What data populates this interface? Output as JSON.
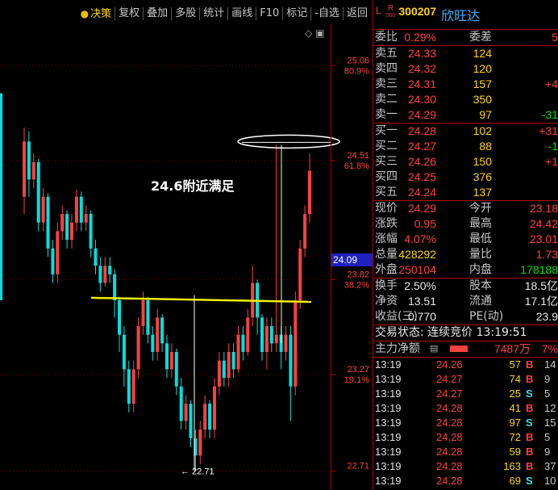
{
  "toolbar": {
    "items": [
      "决策",
      "复权",
      "叠加",
      "多股",
      "统计",
      "画线",
      "F10",
      "标记",
      "-自选",
      "返回"
    ]
  },
  "chart": {
    "annotation": "24.6附近满足",
    "low_label": "← 22.71",
    "current_price_tag": "24.09",
    "axis_labels": [
      {
        "price": "25.06",
        "pct": "80.9%"
      },
      {
        "price": "24.51",
        "pct": "61.8%"
      },
      {
        "price": "23.82",
        "pct": "38.2%"
      },
      {
        "price": "23.27",
        "pct": "19.1%"
      },
      {
        "price": "22.71",
        "pct": ""
      }
    ],
    "candle_colors": {
      "up": "#ff4040",
      "down": "#00e0e0",
      "line": "#f0f000"
    }
  },
  "chart_data": {
    "type": "candlestick",
    "y_range": [
      22.6,
      25.3
    ],
    "fib_levels": [
      25.06,
      24.51,
      23.82,
      23.27,
      22.71
    ],
    "support_line_price": 23.7,
    "candles": [
      {
        "o": 24.3,
        "c": 24.62,
        "h": 24.7,
        "l": 24.2
      },
      {
        "o": 24.62,
        "c": 24.4,
        "h": 24.68,
        "l": 24.3
      },
      {
        "o": 24.4,
        "c": 24.5,
        "h": 24.55,
        "l": 24.35
      },
      {
        "o": 24.5,
        "c": 24.15,
        "h": 24.52,
        "l": 24.1
      },
      {
        "o": 24.15,
        "c": 24.3,
        "h": 24.35,
        "l": 24.1
      },
      {
        "o": 24.3,
        "c": 24.0,
        "h": 24.32,
        "l": 23.95
      },
      {
        "o": 24.0,
        "c": 23.85,
        "h": 24.05,
        "l": 23.8
      },
      {
        "o": 23.85,
        "c": 24.1,
        "h": 24.15,
        "l": 23.8
      },
      {
        "o": 24.1,
        "c": 24.2,
        "h": 24.25,
        "l": 24.05
      },
      {
        "o": 24.2,
        "c": 24.05,
        "h": 24.22,
        "l": 24.0
      },
      {
        "o": 24.05,
        "c": 24.15,
        "h": 24.2,
        "l": 24.0
      },
      {
        "o": 24.15,
        "c": 24.3,
        "h": 24.34,
        "l": 24.1
      },
      {
        "o": 24.3,
        "c": 24.15,
        "h": 24.33,
        "l": 24.1
      },
      {
        "o": 24.15,
        "c": 24.2,
        "h": 24.25,
        "l": 24.1
      },
      {
        "o": 24.2,
        "c": 24.0,
        "h": 24.22,
        "l": 23.95
      },
      {
        "o": 24.0,
        "c": 23.9,
        "h": 24.05,
        "l": 23.85
      },
      {
        "o": 23.9,
        "c": 23.8,
        "h": 23.95,
        "l": 23.75
      },
      {
        "o": 23.8,
        "c": 23.9,
        "h": 23.95,
        "l": 23.78
      },
      {
        "o": 23.9,
        "c": 23.85,
        "h": 23.95,
        "l": 23.8
      },
      {
        "o": 23.85,
        "c": 23.7,
        "h": 23.88,
        "l": 23.6
      },
      {
        "o": 23.7,
        "c": 23.5,
        "h": 23.72,
        "l": 23.4
      },
      {
        "o": 23.5,
        "c": 23.3,
        "h": 23.55,
        "l": 23.2
      },
      {
        "o": 23.3,
        "c": 23.1,
        "h": 23.35,
        "l": 23.05
      },
      {
        "o": 23.1,
        "c": 23.3,
        "h": 23.35,
        "l": 23.05
      },
      {
        "o": 23.3,
        "c": 23.55,
        "h": 23.6,
        "l": 23.25
      },
      {
        "o": 23.55,
        "c": 23.7,
        "h": 23.75,
        "l": 23.5
      },
      {
        "o": 23.7,
        "c": 23.5,
        "h": 23.72,
        "l": 23.45
      },
      {
        "o": 23.5,
        "c": 23.4,
        "h": 23.55,
        "l": 23.35
      },
      {
        "o": 23.4,
        "c": 23.6,
        "h": 23.65,
        "l": 23.35
      },
      {
        "o": 23.6,
        "c": 23.45,
        "h": 23.62,
        "l": 23.4
      },
      {
        "o": 23.45,
        "c": 23.3,
        "h": 23.5,
        "l": 23.25
      },
      {
        "o": 23.3,
        "c": 23.4,
        "h": 23.45,
        "l": 23.25
      },
      {
        "o": 23.4,
        "c": 23.2,
        "h": 23.42,
        "l": 23.15
      },
      {
        "o": 23.2,
        "c": 23.0,
        "h": 23.25,
        "l": 22.95
      },
      {
        "o": 23.0,
        "c": 23.1,
        "h": 23.15,
        "l": 22.95
      },
      {
        "o": 23.1,
        "c": 22.9,
        "h": 23.12,
        "l": 22.85
      },
      {
        "o": 22.9,
        "c": 22.8,
        "h": 22.95,
        "l": 22.71
      },
      {
        "o": 22.8,
        "c": 22.95,
        "h": 23.0,
        "l": 22.75
      },
      {
        "o": 22.95,
        "c": 23.1,
        "h": 23.15,
        "l": 22.9
      },
      {
        "o": 23.1,
        "c": 22.95,
        "h": 23.12,
        "l": 22.9
      },
      {
        "o": 22.95,
        "c": 23.2,
        "h": 23.25,
        "l": 22.9
      },
      {
        "o": 23.2,
        "c": 23.35,
        "h": 23.4,
        "l": 23.15
      },
      {
        "o": 23.35,
        "c": 23.25,
        "h": 23.4,
        "l": 23.2
      },
      {
        "o": 23.25,
        "c": 23.4,
        "h": 23.45,
        "l": 23.2
      },
      {
        "o": 23.4,
        "c": 23.3,
        "h": 23.45,
        "l": 23.25
      },
      {
        "o": 23.3,
        "c": 23.5,
        "h": 23.55,
        "l": 23.28
      },
      {
        "o": 23.5,
        "c": 23.4,
        "h": 23.55,
        "l": 23.35
      },
      {
        "o": 23.4,
        "c": 23.6,
        "h": 23.65,
        "l": 23.38
      },
      {
        "o": 23.6,
        "c": 23.8,
        "h": 23.9,
        "l": 23.55
      },
      {
        "o": 23.8,
        "c": 23.6,
        "h": 23.82,
        "l": 23.5
      },
      {
        "o": 23.6,
        "c": 23.4,
        "h": 23.62,
        "l": 23.35
      },
      {
        "o": 23.4,
        "c": 23.55,
        "h": 23.6,
        "l": 23.3
      },
      {
        "o": 23.55,
        "c": 23.45,
        "h": 23.6,
        "l": 23.4
      },
      {
        "o": 23.45,
        "c": 23.5,
        "h": 24.6,
        "l": 23.4
      },
      {
        "o": 23.5,
        "c": 23.4,
        "h": 23.55,
        "l": 23.3
      },
      {
        "o": 23.4,
        "c": 23.5,
        "h": 23.55,
        "l": 23.35
      },
      {
        "o": 23.5,
        "c": 23.2,
        "h": 23.55,
        "l": 23.0
      },
      {
        "o": 23.2,
        "c": 23.7,
        "h": 23.75,
        "l": 23.15
      },
      {
        "o": 23.7,
        "c": 24.0,
        "h": 24.05,
        "l": 23.65
      },
      {
        "o": 24.0,
        "c": 24.2,
        "h": 24.25,
        "l": 23.95
      },
      {
        "o": 24.2,
        "c": 24.45,
        "h": 24.55,
        "l": 24.15
      }
    ]
  },
  "stock": {
    "market": "L",
    "badge": "R",
    "badge_sub": "500",
    "code": "300207",
    "name": "欣旺达"
  },
  "quote": {
    "weibi_label": "委比",
    "weibi": "0.29%",
    "weicha_label": "委差",
    "weicha": "5",
    "asks": [
      {
        "label": "卖五",
        "price": "24.33",
        "vol": "124",
        "chg": ""
      },
      {
        "label": "卖四",
        "price": "24.32",
        "vol": "120",
        "chg": ""
      },
      {
        "label": "卖三",
        "price": "24.31",
        "vol": "157",
        "chg": "+4"
      },
      {
        "label": "卖二",
        "price": "24.30",
        "vol": "350",
        "chg": ""
      },
      {
        "label": "卖一",
        "price": "24.29",
        "vol": "97",
        "chg": "-31"
      }
    ],
    "bids": [
      {
        "label": "买一",
        "price": "24.28",
        "vol": "102",
        "chg": "+31"
      },
      {
        "label": "买二",
        "price": "24.27",
        "vol": "88",
        "chg": "-1"
      },
      {
        "label": "买三",
        "price": "24.26",
        "vol": "150",
        "chg": "+1"
      },
      {
        "label": "买四",
        "price": "24.25",
        "vol": "376",
        "chg": ""
      },
      {
        "label": "买五",
        "price": "24.24",
        "vol": "137",
        "chg": ""
      }
    ],
    "stats": [
      {
        "l1": "现价",
        "v1": "24.29",
        "c1": "red",
        "l2": "今开",
        "v2": "23.18",
        "c2": "red"
      },
      {
        "l1": "涨跌",
        "v1": "0.95",
        "c1": "red",
        "l2": "最高",
        "v2": "24.42",
        "c2": "red"
      },
      {
        "l1": "涨幅",
        "v1": "4.07%",
        "c1": "red",
        "l2": "最低",
        "v2": "23.01",
        "c2": "red"
      },
      {
        "l1": "总量",
        "v1": "428292",
        "c1": "yellow",
        "l2": "量比",
        "v2": "1.73",
        "c2": "red"
      },
      {
        "l1": "外盘",
        "v1": "250104",
        "c1": "red",
        "l2": "内盘",
        "v2": "178188",
        "c2": "green"
      }
    ],
    "stats2": [
      {
        "l1": "换手",
        "v1": "2.50%",
        "l2": "股本",
        "v2": "18.5亿"
      },
      {
        "l1": "净资",
        "v1": "13.51",
        "l2": "流通",
        "v2": "17.1亿"
      },
      {
        "l1": "收益(三)",
        "v1": "0.770",
        "l2": "PE(动)",
        "v2": "23.9"
      }
    ],
    "trade_status": "交易状态: 连续竞价 13:19:51",
    "main_flow_label": "主力净额",
    "main_flow_value": "7487万",
    "main_flow_pct": "7%"
  },
  "ticks": [
    {
      "t": "13:19",
      "p": "24.26",
      "q": "57",
      "s": "B",
      "n": "14"
    },
    {
      "t": "13:19",
      "p": "24.27",
      "q": "74",
      "s": "B",
      "n": "9"
    },
    {
      "t": "13:19",
      "p": "24.27",
      "q": "25",
      "s": "S",
      "n": "5"
    },
    {
      "t": "13:19",
      "p": "24.28",
      "q": "41",
      "s": "B",
      "n": "12"
    },
    {
      "t": "13:19",
      "p": "24.28",
      "q": "97",
      "s": "S",
      "n": "15"
    },
    {
      "t": "13:19",
      "p": "24.28",
      "q": "72",
      "s": "B",
      "n": "5"
    },
    {
      "t": "13:19",
      "p": "24.28",
      "q": "59",
      "s": "B",
      "n": "9"
    },
    {
      "t": "13:19",
      "p": "24.28",
      "q": "163",
      "s": "B",
      "n": "37"
    },
    {
      "t": "13:19",
      "p": "24.28",
      "q": "69",
      "s": "S",
      "n": "10"
    }
  ]
}
